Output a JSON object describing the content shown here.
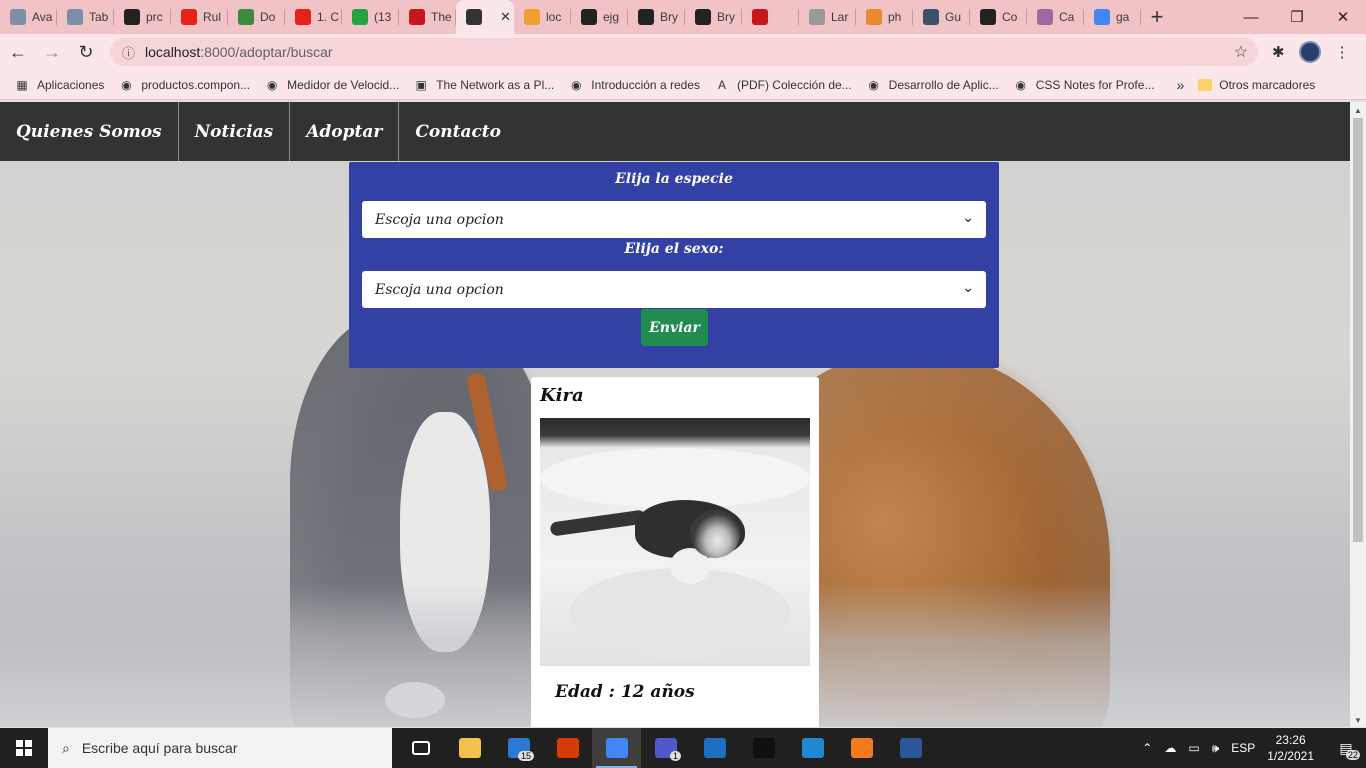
{
  "browser": {
    "tabs": [
      {
        "title": "Ava",
        "icon": "site-icon",
        "color": "#7a8fa8"
      },
      {
        "title": "Tab",
        "icon": "site-icon",
        "color": "#7a8fa8"
      },
      {
        "title": "prc",
        "icon": "github-icon",
        "color": "#222222"
      },
      {
        "title": "Rul",
        "icon": "youtube-icon",
        "color": "#e62117"
      },
      {
        "title": "Do",
        "icon": "site-icon",
        "color": "#3c8a3c"
      },
      {
        "title": "1. C",
        "icon": "youtube-icon",
        "color": "#e62117"
      },
      {
        "title": "(13",
        "icon": "whatsapp-icon",
        "color": "#25a244"
      },
      {
        "title": "The",
        "icon": "site-icon",
        "color": "#c4161c"
      },
      {
        "title": "",
        "icon": "globe-icon",
        "color": "#333333",
        "active": true
      },
      {
        "title": "loc",
        "icon": "pma-icon",
        "color": "#f0a030"
      },
      {
        "title": "ejg",
        "icon": "github-icon",
        "color": "#222222"
      },
      {
        "title": "Bry",
        "icon": "github-icon",
        "color": "#222222"
      },
      {
        "title": "Bry",
        "icon": "github-icon",
        "color": "#222222"
      },
      {
        "title": "",
        "icon": "bootstrap-icon",
        "color": "#c4161c"
      },
      {
        "title": "Lar",
        "icon": "site-icon",
        "color": "#999999"
      },
      {
        "title": "ph",
        "icon": "site-icon",
        "color": "#e88a2e"
      },
      {
        "title": "Gu",
        "icon": "site-icon",
        "color": "#39516a"
      },
      {
        "title": "Co",
        "icon": "github-icon",
        "color": "#222222"
      },
      {
        "title": "Ca",
        "icon": "site-icon",
        "color": "#9a6aa0"
      },
      {
        "title": "ga",
        "icon": "google-icon",
        "color": "#4285f4"
      }
    ],
    "new_tab": "+",
    "controls": {
      "minimize": "—",
      "maximize": "❐",
      "close": "✕"
    },
    "tab_close": "✕",
    "url_host": "localhost",
    "url_path": ":8000/adoptar/buscar",
    "bookmarks": [
      {
        "label": "Aplicaciones",
        "icon": "apps-grid-icon"
      },
      {
        "label": "productos.compon...",
        "icon": "globe-icon"
      },
      {
        "label": "Medidor de Velocid...",
        "icon": "globe-icon"
      },
      {
        "label": "The Network as a Pl...",
        "icon": "cp-icon"
      },
      {
        "label": "Introducción a redes",
        "icon": "globe-icon"
      },
      {
        "label": "(PDF) Colección de...",
        "icon": "academia-icon"
      },
      {
        "label": "Desarrollo de Aplic...",
        "icon": "site-icon"
      },
      {
        "label": "CSS Notes for Profe...",
        "icon": "globe-icon"
      }
    ],
    "bookmarks_more": "»",
    "other_bookmarks": "Otros marcadores"
  },
  "site": {
    "nav": [
      "Quienes Somos",
      "Noticias",
      "Adoptar",
      "Contacto"
    ],
    "form": {
      "species_label": "Elija la especie",
      "species_value": "Escoja una opcion",
      "sex_label": "Elija el sexo:",
      "sex_value": "Escoja una opcion",
      "submit": "Enviar"
    },
    "pet": {
      "name": "Kira",
      "age": "Edad : 12 años"
    }
  },
  "taskbar": {
    "search_placeholder": "Escribe aquí para buscar",
    "apps": [
      {
        "name": "task-view-icon",
        "label": "",
        "color": "#202020"
      },
      {
        "name": "file-explorer-icon",
        "label": "",
        "color": "#f2c14e"
      },
      {
        "name": "mail-icon",
        "label": "",
        "color": "#2b79d0",
        "badge": "15"
      },
      {
        "name": "office-icon",
        "label": "",
        "color": "#d83b01"
      },
      {
        "name": "chrome-icon",
        "label": "",
        "color": "#4285f4",
        "active": true
      },
      {
        "name": "teams-icon",
        "label": "",
        "color": "#5059c9",
        "badge": "1"
      },
      {
        "name": "media-player-icon",
        "label": "",
        "color": "#1e6fc0"
      },
      {
        "name": "terminal-icon",
        "label": "",
        "color": "#101010"
      },
      {
        "name": "vscode-icon",
        "label": "",
        "color": "#1f8ad2"
      },
      {
        "name": "xampp-icon",
        "label": "",
        "color": "#f47a20"
      },
      {
        "name": "word-icon",
        "label": "",
        "color": "#2b579a"
      }
    ],
    "language": "ESP",
    "time": "23:26",
    "date": "1/2/2021",
    "notifications": "22"
  }
}
